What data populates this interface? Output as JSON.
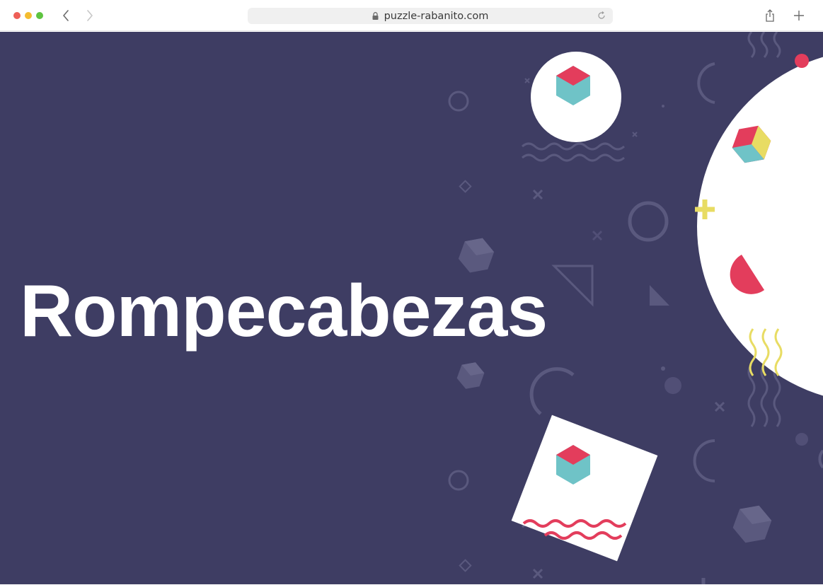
{
  "browser": {
    "url": "puzzle-rabanito.com",
    "icons": {
      "back": "chevron-left-icon",
      "forward": "chevron-right-icon",
      "lock": "lock-icon",
      "reload": "reload-icon",
      "share": "share-icon",
      "new_tab": "plus-icon"
    }
  },
  "hero": {
    "title": "Rompecabezas"
  },
  "colors": {
    "background": "#3e3d63",
    "pink": "#e33d5c",
    "teal": "#6fc3c7",
    "yellow": "#e8dc63",
    "muted_shape": "#59587d"
  }
}
